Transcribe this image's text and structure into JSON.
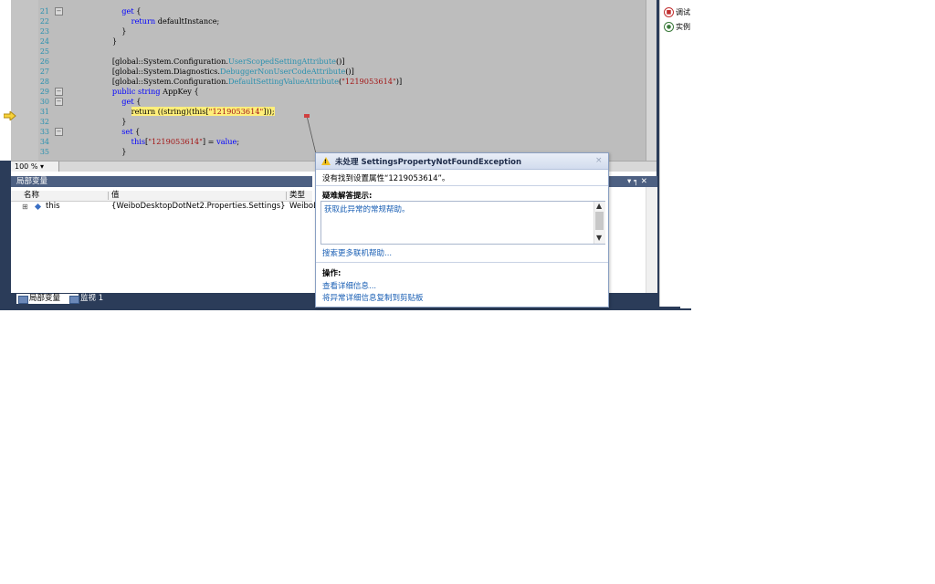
{
  "editor": {
    "lines": [
      {
        "num": "21",
        "fold": "−",
        "code": [
          {
            "t": "            "
          },
          {
            "t": "get",
            "c": "kw"
          },
          {
            "t": " {"
          }
        ]
      },
      {
        "num": "22",
        "fold": "",
        "code": [
          {
            "t": "                "
          },
          {
            "t": "return",
            "c": "kw"
          },
          {
            "t": " defaultInstance;"
          }
        ]
      },
      {
        "num": "23",
        "fold": "",
        "code": [
          {
            "t": "            }"
          }
        ]
      },
      {
        "num": "24",
        "fold": "",
        "code": [
          {
            "t": "        }"
          }
        ]
      },
      {
        "num": "25",
        "fold": "",
        "code": [
          {
            "t": ""
          }
        ]
      },
      {
        "num": "26",
        "fold": "",
        "code": [
          {
            "t": "        [global::System.Configuration."
          },
          {
            "t": "UserScopedSettingAttribute",
            "c": "ty"
          },
          {
            "t": "()]"
          }
        ]
      },
      {
        "num": "27",
        "fold": "",
        "code": [
          {
            "t": "        [global::System.Diagnostics."
          },
          {
            "t": "DebuggerNonUserCodeAttribute",
            "c": "ty"
          },
          {
            "t": "()]"
          }
        ]
      },
      {
        "num": "28",
        "fold": "",
        "code": [
          {
            "t": "        [global::System.Configuration."
          },
          {
            "t": "DefaultSettingValueAttribute",
            "c": "ty"
          },
          {
            "t": "("
          },
          {
            "t": "\"1219053614\"",
            "c": "st"
          },
          {
            "t": ")]"
          }
        ]
      },
      {
        "num": "29",
        "fold": "−",
        "code": [
          {
            "t": "        "
          },
          {
            "t": "public string",
            "c": "kw"
          },
          {
            "t": " AppKey {"
          }
        ]
      },
      {
        "num": "30",
        "fold": "−",
        "code": [
          {
            "t": "            "
          },
          {
            "t": "get",
            "c": "kw"
          },
          {
            "t": " {"
          }
        ]
      },
      {
        "num": "31",
        "fold": "",
        "code": [
          {
            "t": "                "
          },
          {
            "t": "return ((string)(this[",
            "c": "hl"
          },
          {
            "t": "\"1219053614\"",
            "c": "hl st"
          },
          {
            "t": "]));",
            "c": "hl"
          }
        ]
      },
      {
        "num": "32",
        "fold": "",
        "code": [
          {
            "t": "            }"
          }
        ]
      },
      {
        "num": "33",
        "fold": "−",
        "code": [
          {
            "t": "            "
          },
          {
            "t": "set",
            "c": "kw"
          },
          {
            "t": " {"
          }
        ]
      },
      {
        "num": "34",
        "fold": "",
        "code": [
          {
            "t": "                "
          },
          {
            "t": "this",
            "c": "kw"
          },
          {
            "t": "["
          },
          {
            "t": "\"1219053614\"",
            "c": "st"
          },
          {
            "t": "] = "
          },
          {
            "t": "value",
            "c": "kw"
          },
          {
            "t": ";"
          }
        ]
      },
      {
        "num": "35",
        "fold": "",
        "code": [
          {
            "t": "            }"
          }
        ]
      }
    ],
    "zoom": "100 %"
  },
  "locals": {
    "title": "局部变量",
    "col_name": "名称",
    "col_value": "值",
    "col_type": "类型",
    "row": {
      "expander": "⊞",
      "name": "this",
      "value": "{WeiboDesktopDotNet2.Properties.Settings}",
      "type": "WeiboD"
    }
  },
  "tabs": {
    "locals": "局部变量",
    "watch": "监视 1"
  },
  "right_panel": {
    "controls": "▾ ╕ ✕",
    "items": [
      {
        "icon": "stop",
        "label": "调试"
      },
      {
        "icon": "search",
        "label": "实例"
      }
    ]
  },
  "exception": {
    "title": "未处理 SettingsPropertyNotFoundException",
    "close": "×",
    "message": "没有找到设置属性“1219053614”。",
    "tips_heading": "疑难解答提示:",
    "tips_link": "获取此异常的常规帮助。",
    "more_help": "搜索更多联机帮助...",
    "actions_heading": "操作:",
    "actions": [
      "查看详细信息...",
      "将异常详细信息复制到剪贴板"
    ]
  },
  "colors": {
    "editor_bg": "#bdbdbd",
    "panel_title": "#4d6082",
    "frame": "#2b3c59",
    "link": "#1a5fb4",
    "highlight": "#ffef7a"
  }
}
